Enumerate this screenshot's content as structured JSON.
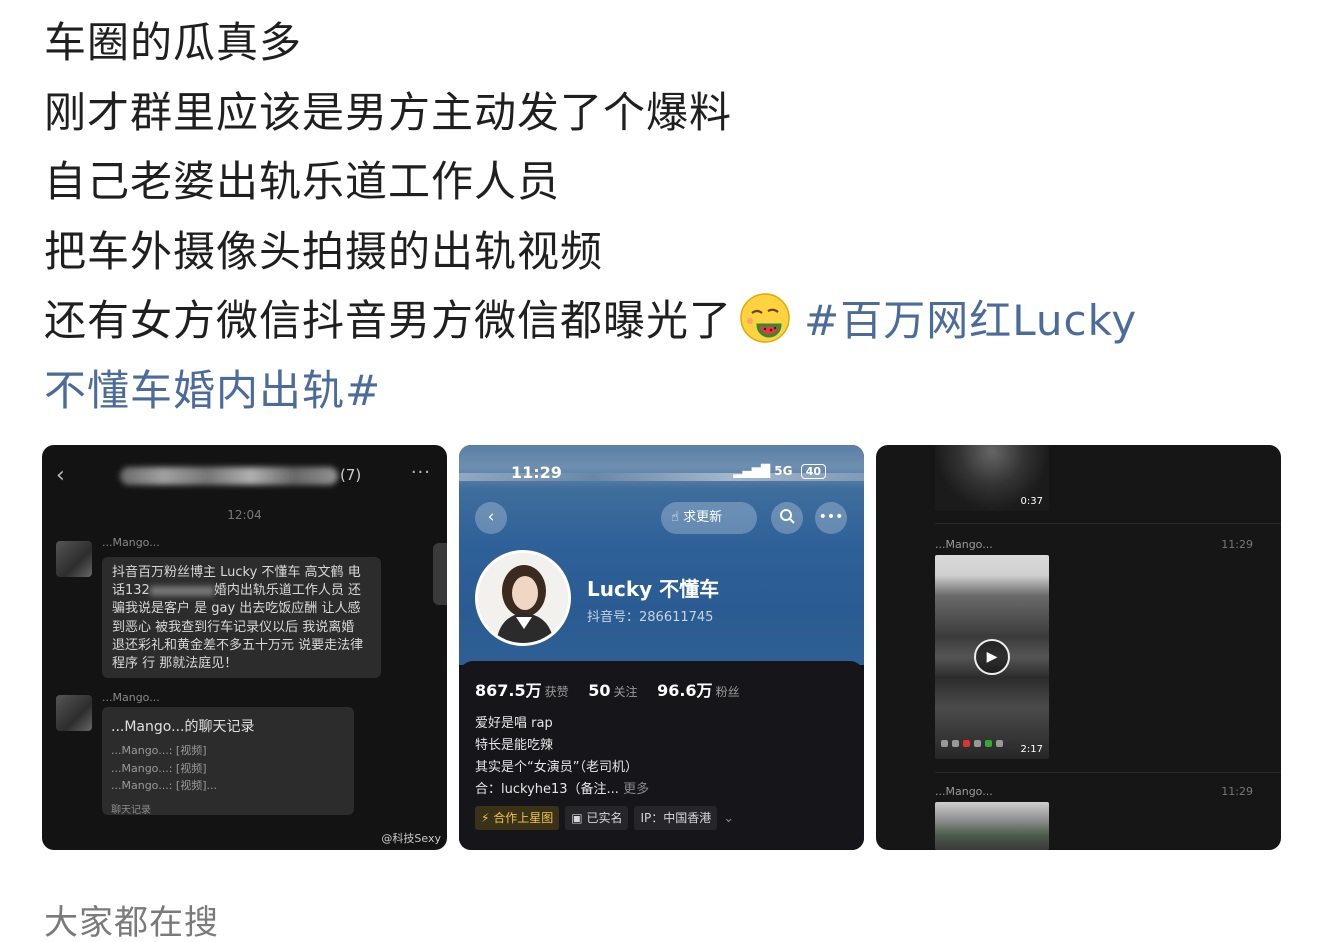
{
  "post": {
    "lines": [
      "车圈的瓜真多",
      "刚才群里应该是男方主动发了个爆料",
      "自己老婆出轨乐道工作人员",
      "把车外摄像头拍摄的出轨视频",
      "还有女方微信抖音男方微信都曝光了"
    ],
    "topic_part1": "#百万网红Lucky",
    "topic_part2": "不懂车婚内出轨#",
    "emoji": "watermelon-emoji"
  },
  "chat": {
    "back_icon": "‹",
    "member_count": "(7)",
    "more_icon": "···",
    "time": "12:04",
    "sender1": "...Mango...",
    "message1_pre": "抖音百万粉丝博主 Lucky 不懂车 高文鹤 电话132",
    "message1_post": "婚内出轨乐道工作人员 还骗我说是客户 是 gay 出去吃饭应酬 让人感到恶心 被我查到行车记录仪以后 我说离婚 退还彩礼和黄金差不多五十万元 说要走法律程序 行 那就法庭见！",
    "sender2": "...Mango...",
    "record_title": "...Mango...的聊天记录",
    "record_rows": [
      "...Mango...: [视频]",
      "...Mango...: [视频]",
      "...Mango...: [视频]..."
    ],
    "record_footer": "聊天记录",
    "watermark": "@科技Sexy"
  },
  "profile": {
    "time": "11:29",
    "network": "5G",
    "battery": "40",
    "update_label": "求更新",
    "name": "Lucky 不懂车",
    "douyin_id": "抖音号：286611745",
    "likes": "867.5万",
    "likes_label": "获赞",
    "following": "50",
    "following_label": "关注",
    "followers": "96.6万",
    "followers_label": "粉丝",
    "bio": [
      "爱好是唱 rap",
      "特长是能吃辣",
      "其实是个“女演员”（老司机）"
    ],
    "contact": "合：luckyhe13（备注...",
    "more": "更多",
    "tag_star": "合作上星图",
    "tag_verified": "已实名",
    "tag_ip": "IP：中国香港"
  },
  "videos": {
    "dur1": "0:37",
    "sender1": "...Mango...",
    "time1": "11:29",
    "dur2": "2:17",
    "sender2": "...Mango...",
    "time2": "11:29"
  },
  "footer": {
    "heading": "大家都在搜"
  },
  "colors": {
    "topic": "#4b6b9c",
    "gold_tag": "#f0c04a"
  }
}
